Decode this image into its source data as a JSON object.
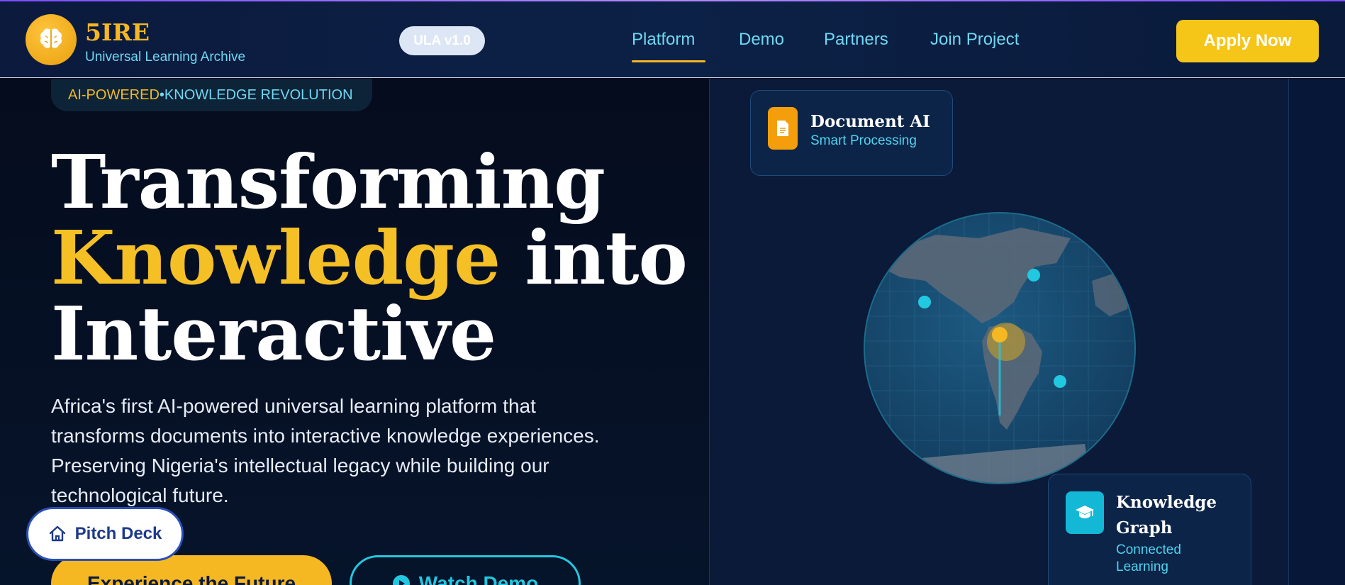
{
  "header": {
    "brand_name": "5IRE",
    "brand_subtitle": "Universal Learning Archive",
    "version_badge": "ULA v1.0",
    "nav": [
      "Platform",
      "Demo",
      "Partners",
      "Join Project"
    ],
    "active_nav": "Platform",
    "cta": "Apply Now"
  },
  "hero": {
    "badge_part1": "AI-POWERED",
    "badge_separator": " • ",
    "badge_part2": "KNOWLEDGE REVOLUTION",
    "headline_line1": "Transforming",
    "headline_highlight": "Knowledge",
    "headline_after_highlight": " into",
    "headline_line3": "Interactive",
    "description": "Africa's first AI-powered universal learning platform that transforms documents into interactive knowledge experiences. Preserving Nigeria's intellectual legacy while building our technological future.",
    "primary_button": "Experience the Future",
    "secondary_button": "Watch Demo",
    "floating_button": "Pitch Deck"
  },
  "cards": {
    "doc_title": "Document AI",
    "doc_subtitle": "Smart Processing",
    "kg_title_line1": "Knowledge",
    "kg_title_line2": "Graph",
    "kg_subtitle_line1": "Connected",
    "kg_subtitle_line2": "Learning"
  },
  "icons": {
    "logo": "brain-icon",
    "doc": "document-icon",
    "kg": "graduation-cap-icon",
    "pitch": "home-icon",
    "watch": "play-icon"
  },
  "colors": {
    "gold": "#f5b823",
    "cyan": "#22c8e0",
    "navy": "#0b1a3d"
  }
}
